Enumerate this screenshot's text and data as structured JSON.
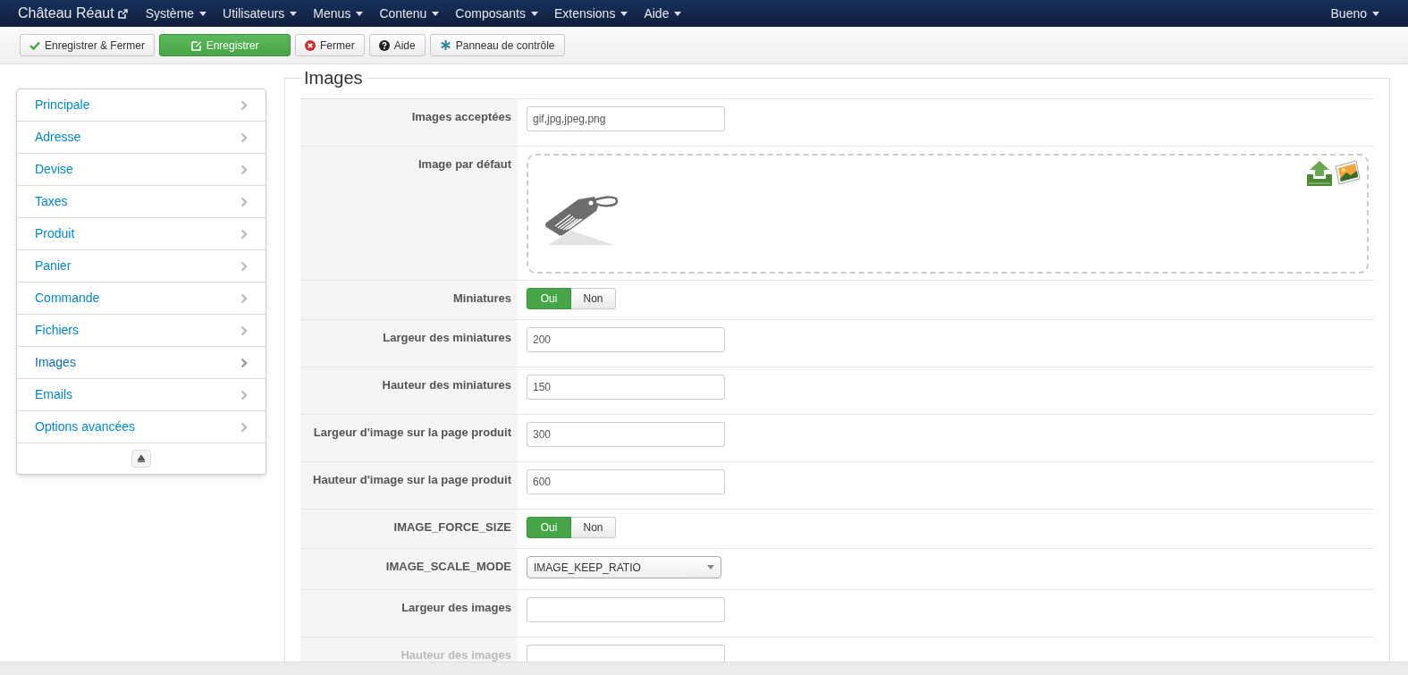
{
  "navbar": {
    "brand": "Château Réaut",
    "menus": [
      {
        "label": "Système"
      },
      {
        "label": "Utilisateurs"
      },
      {
        "label": "Menus"
      },
      {
        "label": "Contenu"
      },
      {
        "label": "Composants"
      },
      {
        "label": "Extensions"
      },
      {
        "label": "Aide"
      }
    ],
    "user": "Bueno"
  },
  "toolbar": [
    {
      "kind": "save-close",
      "label": "Enregistrer & Fermer"
    },
    {
      "kind": "save",
      "label": "Enregistrer"
    },
    {
      "kind": "close",
      "label": "Fermer"
    },
    {
      "kind": "help",
      "label": "Aide"
    },
    {
      "kind": "dashboard",
      "label": "Panneau de contrôle"
    }
  ],
  "sidebar": {
    "items": [
      {
        "label": "Principale",
        "selected": false
      },
      {
        "label": "Adresse",
        "selected": false
      },
      {
        "label": "Devise",
        "selected": false
      },
      {
        "label": "Taxes",
        "selected": false
      },
      {
        "label": "Produit",
        "selected": false
      },
      {
        "label": "Panier",
        "selected": false
      },
      {
        "label": "Commande",
        "selected": false
      },
      {
        "label": "Fichiers",
        "selected": false
      },
      {
        "label": "Images",
        "selected": true
      },
      {
        "label": "Emails",
        "selected": false
      },
      {
        "label": "Options avancées",
        "selected": false
      }
    ]
  },
  "form": {
    "legend": "Images",
    "rows": [
      {
        "kind": "text",
        "label": "Images acceptées",
        "value": "gif,jpg,jpeg,png"
      },
      {
        "kind": "image",
        "label": "Image par défaut"
      },
      {
        "kind": "toggle",
        "label": "Miniatures",
        "options": [
          {
            "label": "Oui",
            "selected": true
          },
          {
            "label": "Non",
            "selected": false
          }
        ]
      },
      {
        "kind": "text",
        "label": "Largeur des miniatures",
        "value": "200"
      },
      {
        "kind": "text",
        "label": "Hauteur des miniatures",
        "value": "150"
      },
      {
        "kind": "text",
        "label": "Largeur d'image sur la page produit",
        "value": "300"
      },
      {
        "kind": "text",
        "label": "Hauteur d'image sur la page produit",
        "value": "600"
      },
      {
        "kind": "toggle",
        "label": "IMAGE_FORCE_SIZE",
        "options": [
          {
            "label": "Oui",
            "selected": true
          },
          {
            "label": "Non",
            "selected": false
          }
        ]
      },
      {
        "kind": "select",
        "label": "IMAGE_SCALE_MODE",
        "value": "IMAGE_KEEP_RATIO"
      },
      {
        "kind": "text",
        "label": "Largeur des images",
        "value": ""
      },
      {
        "kind": "text",
        "label": "Hauteur des images",
        "value": ""
      }
    ]
  }
}
